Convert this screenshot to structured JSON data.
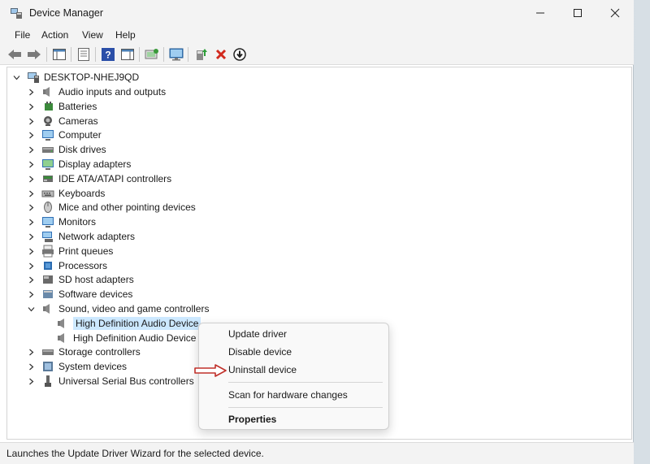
{
  "window": {
    "title": "Device Manager"
  },
  "menu": [
    "File",
    "Action",
    "View",
    "Help"
  ],
  "toolbar": {
    "buttons": [
      "back-icon",
      "forward-icon",
      "show-hide-console-tree-icon",
      "properties-icon",
      "help-icon",
      "action-pane-icon",
      "scan-changes-icon",
      "computer-monitor-icon",
      "update-driver-icon",
      "uninstall-icon",
      "disable-device-icon"
    ]
  },
  "tree": {
    "root": "DESKTOP-NHEJ9QD",
    "categories": [
      "Audio inputs and outputs",
      "Batteries",
      "Cameras",
      "Computer",
      "Disk drives",
      "Display adapters",
      "IDE ATA/ATAPI controllers",
      "Keyboards",
      "Mice and other pointing devices",
      "Monitors",
      "Network adapters",
      "Print queues",
      "Processors",
      "SD host adapters",
      "Software devices",
      "Sound, video and game controllers"
    ],
    "sound_children": [
      "High Definition Audio Device",
      "High Definition Audio Device"
    ],
    "after_categories": [
      "Storage controllers",
      "System devices",
      "Universal Serial Bus controllers"
    ]
  },
  "context_menu": {
    "update_driver": "Update driver",
    "disable_device": "Disable device",
    "uninstall_device": "Uninstall device",
    "scan_hardware": "Scan for hardware changes",
    "properties": "Properties"
  },
  "status": {
    "text": "Launches the Update Driver Wizard for the selected device."
  },
  "colors": {
    "selection": "#cce8ff",
    "arrow": "#c0302a",
    "accent_blue": "#1e7fd4"
  }
}
